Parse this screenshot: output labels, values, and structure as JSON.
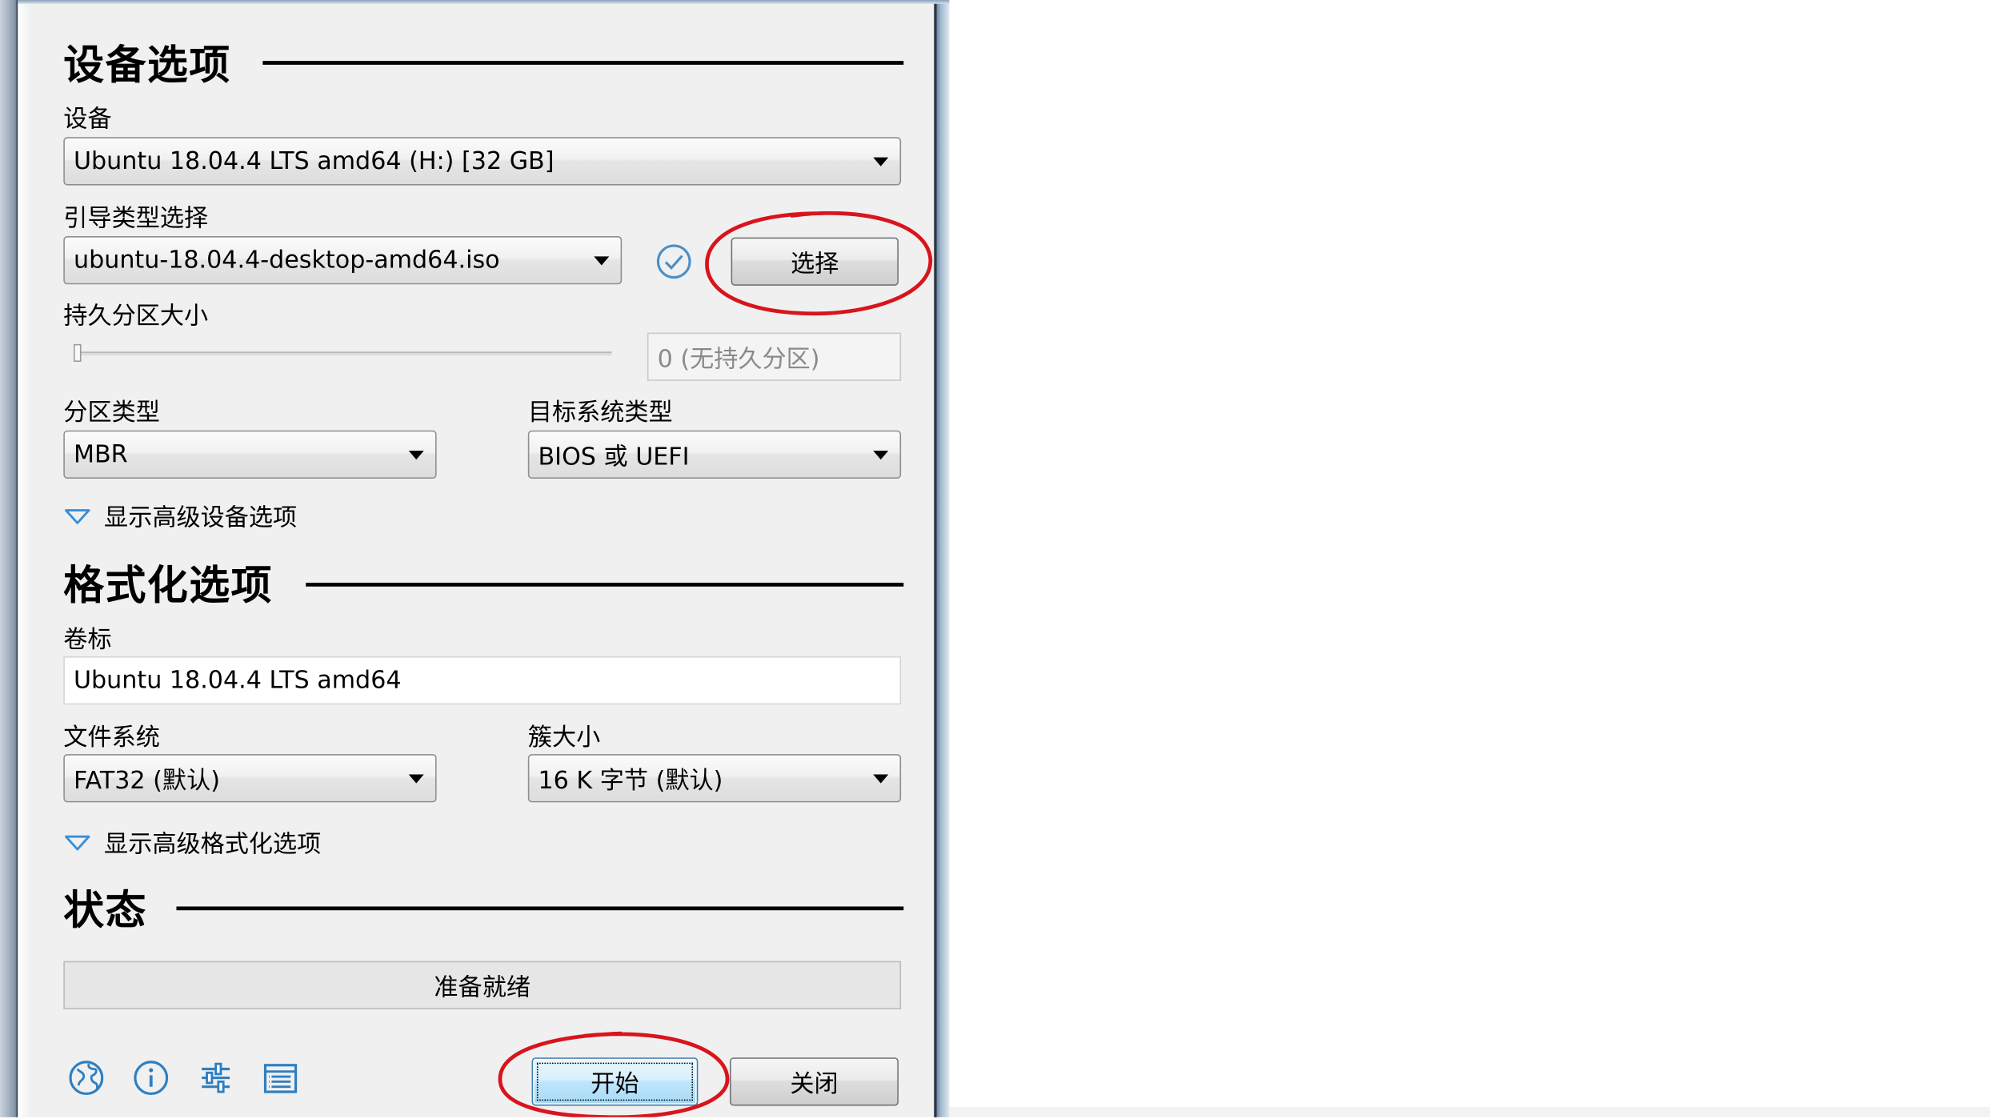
{
  "sections": {
    "device_options": "设备选项",
    "format_options": "格式化选项",
    "status": "状态"
  },
  "device": {
    "label": "设备",
    "value": "Ubuntu 18.04.4 LTS amd64 (H:) [32 GB]"
  },
  "boot_selection": {
    "label": "引导类型选择",
    "value": "ubuntu-18.04.4-desktop-amd64.iso",
    "select_button": "选择"
  },
  "persistent": {
    "label": "持久分区大小",
    "value": "0 (无持久分区)"
  },
  "partition_scheme": {
    "label": "分区类型",
    "value": "MBR"
  },
  "target_system": {
    "label": "目标系统类型",
    "value": "BIOS 或 UEFI"
  },
  "advanced_device": "显示高级设备选项",
  "volume_label": {
    "label": "卷标",
    "value": "Ubuntu 18.04.4 LTS amd64"
  },
  "file_system": {
    "label": "文件系统",
    "value": "FAT32 (默认)"
  },
  "cluster_size": {
    "label": "簇大小",
    "value": "16 K 字节 (默认)"
  },
  "advanced_format": "显示高级格式化选项",
  "status_text": "准备就绪",
  "buttons": {
    "start": "开始",
    "close": "关闭"
  },
  "icons": [
    "language-icon",
    "info-icon",
    "settings-icon",
    "log-icon"
  ],
  "colors": {
    "annotation": "#d8141c",
    "window_bg": "#f0f0f0",
    "check": "#4a90c9"
  }
}
